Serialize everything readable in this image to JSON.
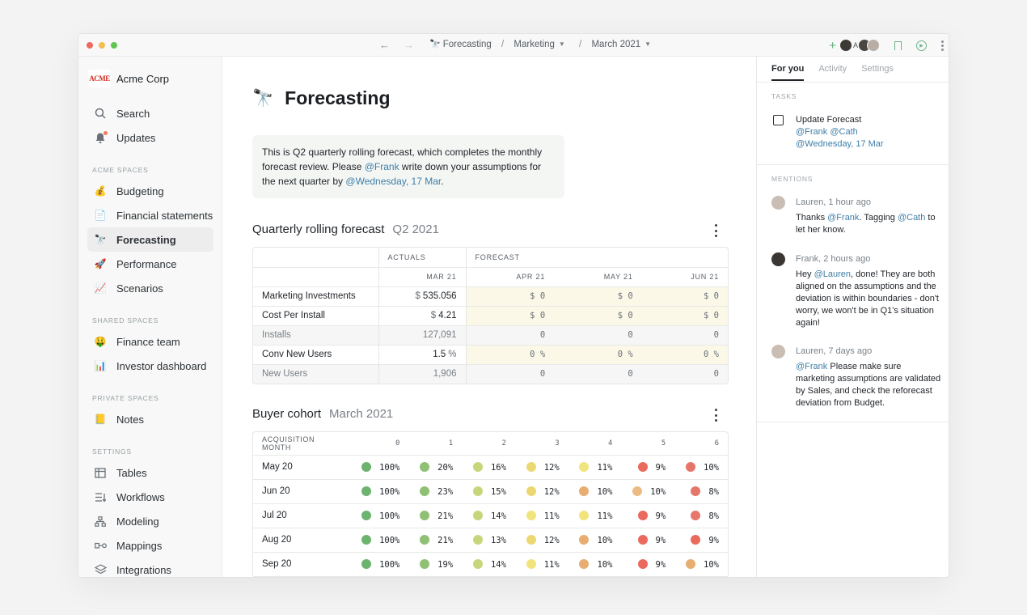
{
  "topbar": {
    "breadcrumbs": [
      {
        "icon": "🔭",
        "label": "Forecasting"
      },
      {
        "label": "Marketing"
      },
      {
        "label": "March 2021"
      }
    ],
    "avatar_initial": "A"
  },
  "sidebar": {
    "org_logo_text": "ACME",
    "org_name": "Acme Corp",
    "top_items": [
      {
        "icon": "search-icon",
        "label": "Search"
      },
      {
        "icon": "bell-icon",
        "label": "Updates"
      }
    ],
    "sections": [
      {
        "title": "ACME SPACES",
        "items": [
          {
            "emoji": "💰",
            "label": "Budgeting"
          },
          {
            "emoji": "📄",
            "label": "Financial statements"
          },
          {
            "emoji": "🔭",
            "label": "Forecasting",
            "active": true
          },
          {
            "emoji": "🚀",
            "label": "Performance"
          },
          {
            "emoji": "📈",
            "label": "Scenarios"
          }
        ]
      },
      {
        "title": "SHARED SPACES",
        "items": [
          {
            "emoji": "🤑",
            "label": "Finance team"
          },
          {
            "emoji": "📊",
            "label": "Investor dashboard"
          }
        ]
      },
      {
        "title": "PRIVATE SPACES",
        "items": [
          {
            "emoji": "📒",
            "label": "Notes"
          }
        ]
      },
      {
        "title": "SETTINGS",
        "items": [
          {
            "icon": "table-icon",
            "label": "Tables"
          },
          {
            "icon": "workflow-icon",
            "label": "Workflows"
          },
          {
            "icon": "model-icon",
            "label": "Modeling"
          },
          {
            "icon": "mapping-icon",
            "label": "Mappings"
          },
          {
            "icon": "layers-icon",
            "label": "Integrations"
          }
        ]
      }
    ]
  },
  "main": {
    "emoji": "🔭",
    "title": "Forecasting",
    "note": {
      "part1": "This is Q2 quarterly rolling forecast, which completes the monthly forecast review. Please ",
      "mention1": "@Frank",
      "part2": " write down your assumptions for the next quarter by ",
      "mention2": "@Wednesday, 17 Mar",
      "part3": "."
    },
    "forecast": {
      "title": "Quarterly rolling forecast",
      "subtitle": "Q2 2021",
      "group_actuals": "ACTUALS",
      "group_forecast": "FORECAST",
      "months": [
        "MAR 21",
        "APR 21",
        "MAY 21",
        "JUN 21"
      ],
      "rows": [
        {
          "label": "Marketing Investments",
          "prefix": "$",
          "actual": "535.056",
          "forecast": [
            "0",
            "0",
            "0"
          ],
          "fprefix": "$",
          "suffix": "",
          "shaded": false
        },
        {
          "label": "Cost Per Install",
          "prefix": "$",
          "actual": "4.21",
          "forecast": [
            "0",
            "0",
            "0"
          ],
          "fprefix": "$",
          "suffix": "",
          "shaded": false
        },
        {
          "label": "Installs",
          "prefix": "",
          "actual": "127,091",
          "forecast": [
            "0",
            "0",
            "0"
          ],
          "fprefix": "",
          "suffix": "",
          "shaded": true
        },
        {
          "label": "Conv New Users",
          "prefix": "",
          "actual": "1.5",
          "forecast": [
            "0",
            "0",
            "0"
          ],
          "fprefix": "",
          "suffix": "%",
          "shaded": false
        },
        {
          "label": "New Users",
          "prefix": "",
          "actual": "1,906",
          "forecast": [
            "0",
            "0",
            "0"
          ],
          "fprefix": "",
          "suffix": "",
          "shaded": true
        }
      ]
    },
    "cohort": {
      "title": "Buyer cohort",
      "subtitle": "March 2021",
      "first_col": "ACQUISITION MONTH",
      "cols": [
        "0",
        "1",
        "2",
        "3",
        "4",
        "5",
        "6"
      ],
      "rows": [
        {
          "label": "May 20",
          "values": [
            "100%",
            "20%",
            "16%",
            "12%",
            "11%",
            "9%",
            "10%"
          ]
        },
        {
          "label": "Jun 20",
          "values": [
            "100%",
            "23%",
            "15%",
            "12%",
            "10%",
            "10%",
            "8%"
          ]
        },
        {
          "label": "Jul 20",
          "values": [
            "100%",
            "21%",
            "14%",
            "11%",
            "11%",
            "9%",
            "8%"
          ]
        },
        {
          "label": "Aug 20",
          "values": [
            "100%",
            "21%",
            "13%",
            "12%",
            "10%",
            "9%",
            "9%"
          ]
        },
        {
          "label": "Sep 20",
          "values": [
            "100%",
            "19%",
            "14%",
            "11%",
            "10%",
            "9%",
            "10%"
          ]
        }
      ],
      "colors": {
        "green": "#6cb36f",
        "green2": "#8fc074",
        "yellowgreen": "#c7d67a",
        "yellow": "#ecd873",
        "lightyellow": "#f2e47d",
        "orange": "#e8ad70",
        "lightorange": "#ecbb83",
        "red": "#ea6b5d",
        "red2": "#e6766a"
      }
    }
  },
  "right_panel": {
    "tabs": [
      "For you",
      "Activity",
      "Settings"
    ],
    "tasks_title": "TASKS",
    "task": {
      "title": "Update Forecast",
      "assignees": "@Frank @Cath",
      "due": "@Wednesday, 17 Mar"
    },
    "mentions_title": "MENTIONS",
    "mentions": [
      {
        "author": "Lauren, 1 hour ago",
        "segments": [
          {
            "t": "Thanks "
          },
          {
            "m": "@Frank"
          },
          {
            "t": ". Tagging "
          },
          {
            "m": "@Cath"
          },
          {
            "t": " to let her know."
          }
        ]
      },
      {
        "author": "Frank, 2 hours ago",
        "segments": [
          {
            "t": "Hey "
          },
          {
            "m": "@Lauren"
          },
          {
            "t": ", done! They are both aligned on the assumptions and the deviation is within boundaries - don't worry, we won't be in Q1's situation again!"
          }
        ]
      },
      {
        "author": "Lauren, 7 days ago",
        "segments": [
          {
            "m": "@Frank"
          },
          {
            "t": " Please make sure marketing assumptions are validated by Sales, and check the reforecast deviation from Budget."
          }
        ]
      }
    ]
  }
}
